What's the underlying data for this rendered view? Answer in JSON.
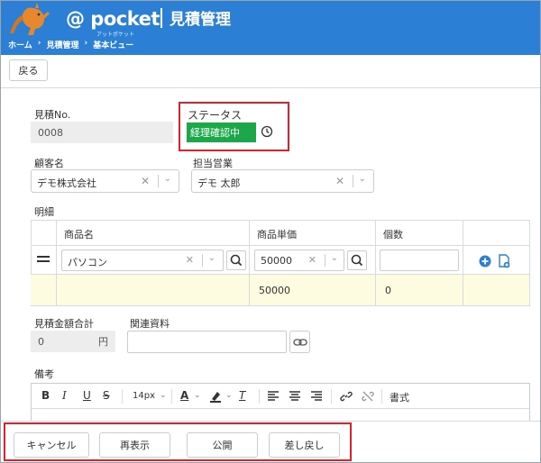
{
  "header": {
    "logo_text": "@ pocket",
    "logo_subtext": "アットポケット",
    "title": "見積管理",
    "brand_color": "#2b7fd4"
  },
  "breadcrumb": [
    "ホーム",
    "見積管理",
    "基本ビュー"
  ],
  "toolbar": {
    "back_label": "戻る"
  },
  "form": {
    "estimate_no_label": "見積No.",
    "estimate_no_value": "0008",
    "status_label": "ステータス",
    "status_value": "経理確認中",
    "status_color": "#1aa84a",
    "customer_label": "顧客名",
    "customer_value": "デモ株式会社",
    "sales_label": "担当営業",
    "sales_value": "デモ 太郎",
    "details_label": "明細",
    "total_label": "見積金額合計",
    "total_value": "0",
    "total_unit": "円",
    "related_label": "関連資料",
    "notes_label": "備考"
  },
  "details_table": {
    "headers": [
      "商品名",
      "商品単価",
      "個数"
    ],
    "row": {
      "product": "パソコン",
      "price": "50000",
      "qty": ""
    },
    "summary": {
      "price": "50000",
      "qty": "0"
    }
  },
  "editor": {
    "font_size": "14px",
    "style_label": "書式",
    "bold": "B",
    "italic": "I",
    "underline": "U",
    "strike": "S",
    "font_color": "A",
    "clear_format": "T"
  },
  "bottom": {
    "cancel": "キャンセル",
    "reload": "再表示",
    "publish": "公開",
    "return": "差し戻し"
  },
  "highlight_color": "#e0202a"
}
